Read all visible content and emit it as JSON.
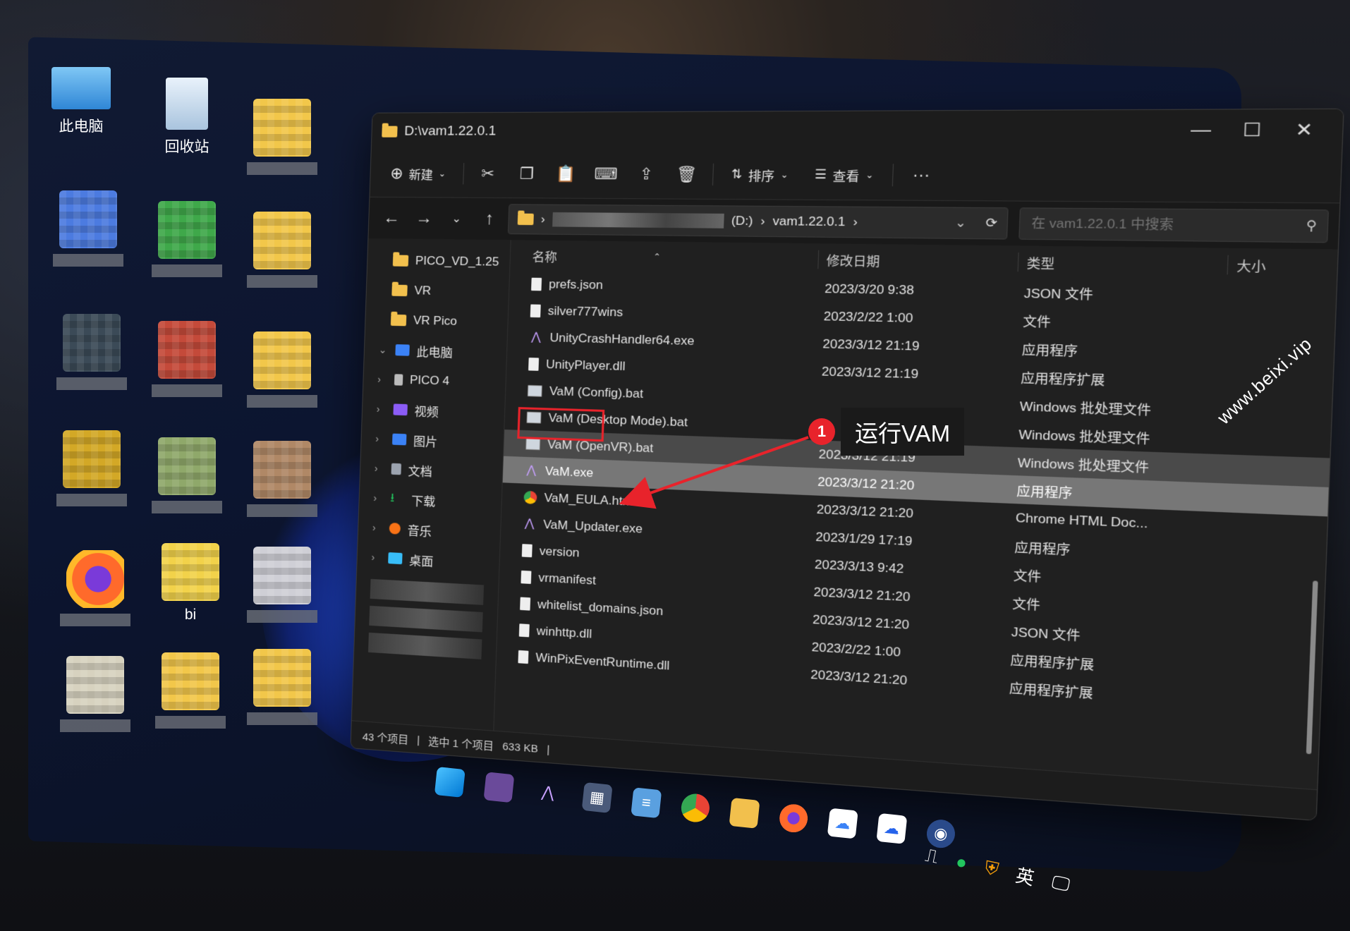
{
  "desktop": {
    "icons": [
      {
        "label": "此电脑",
        "icon": "computer-icon"
      },
      {
        "label": "回收站",
        "icon": "recycle-bin-icon"
      },
      {
        "label": "",
        "icon": "folder-icon"
      },
      {
        "label": "bi",
        "icon": "pixelated-app-icon"
      }
    ]
  },
  "window": {
    "title": "D:\\vam1.22.0.1",
    "controls": {
      "minimize": "—",
      "maximize": "☐",
      "close": "✕"
    }
  },
  "toolbar": {
    "new_label": "新建",
    "sort_label": "排序",
    "view_label": "查看",
    "more_label": "···"
  },
  "address": {
    "drive_partial": "(D:)",
    "current_folder": "vam1.22.0.1",
    "search_placeholder": "在 vam1.22.0.1 中搜索"
  },
  "sidebar": {
    "quick": [
      {
        "label": "PICO_VD_1.25"
      },
      {
        "label": "VR"
      },
      {
        "label": "VR Pico"
      }
    ],
    "this_pc": "此电脑",
    "tree": [
      {
        "label": "PICO 4",
        "color": "#bbbbbb"
      },
      {
        "label": "视频",
        "color": "#8b5cf6"
      },
      {
        "label": "图片",
        "color": "#3b82f6"
      },
      {
        "label": "文档",
        "color": "#9ca3af"
      },
      {
        "label": "下载",
        "color": "#22c55e"
      },
      {
        "label": "音乐",
        "color": "#f97316"
      },
      {
        "label": "桌面",
        "color": "#38bdf8"
      }
    ]
  },
  "columns": {
    "name": "名称",
    "date": "修改日期",
    "type": "类型",
    "size": "大小"
  },
  "files": [
    {
      "name": "prefs.json",
      "date": "2023/3/20 9:38",
      "type": "JSON 文件",
      "kind": "file"
    },
    {
      "name": "silver777wins",
      "date": "2023/2/22 1:00",
      "type": "文件",
      "kind": "file"
    },
    {
      "name": "UnityCrashHandler64.exe",
      "date": "2023/3/12 21:19",
      "type": "应用程序",
      "kind": "exe"
    },
    {
      "name": "UnityPlayer.dll",
      "date": "2023/3/12 21:19",
      "type": "应用程序扩展",
      "kind": "file"
    },
    {
      "name": "VaM (Config).bat",
      "date": "",
      "type": "Windows 批处理文件",
      "kind": "bat"
    },
    {
      "name": "VaM (Desktop Mode).bat",
      "date": "",
      "type": "Windows 批处理文件",
      "kind": "bat"
    },
    {
      "name": "VaM (OpenVR).bat",
      "date": "2023/3/12 21:19",
      "type": "Windows 批处理文件",
      "kind": "bat"
    },
    {
      "name": "VaM.exe",
      "date": "2023/3/12 21:20",
      "type": "应用程序",
      "kind": "exe"
    },
    {
      "name": "VaM_EULA.html",
      "date": "2023/3/12 21:20",
      "type": "Chrome HTML Doc...",
      "kind": "chrome"
    },
    {
      "name": "VaM_Updater.exe",
      "date": "2023/1/29 17:19",
      "type": "应用程序",
      "kind": "exe"
    },
    {
      "name": "version",
      "date": "2023/3/13 9:42",
      "type": "文件",
      "kind": "file"
    },
    {
      "name": "vrmanifest",
      "date": "2023/3/12 21:20",
      "type": "文件",
      "kind": "file"
    },
    {
      "name": "whitelist_domains.json",
      "date": "2023/3/12 21:20",
      "type": "JSON 文件",
      "kind": "file"
    },
    {
      "name": "winhttp.dll",
      "date": "2023/2/22 1:00",
      "type": "应用程序扩展",
      "kind": "file"
    },
    {
      "name": "WinPixEventRuntime.dll",
      "date": "2023/3/12 21:20",
      "type": "应用程序扩展",
      "kind": "file"
    }
  ],
  "status": {
    "count": "43 个项目",
    "selected": "选中 1 个项目",
    "size": "633 KB"
  },
  "callout": {
    "number": "1",
    "text": "运行VAM",
    "color": "#e8232b"
  },
  "taskbar": {
    "icons": [
      "windows-start-icon",
      "vam-icon",
      "calculator-icon",
      "notepad-icon",
      "chrome-icon",
      "file-explorer-icon",
      "firefox-icon",
      "cloud-app-icon",
      "cloud-drive-icon",
      "vr-app-icon"
    ]
  },
  "tray": {
    "language": "英"
  },
  "watermark": "www.beixi.vip"
}
